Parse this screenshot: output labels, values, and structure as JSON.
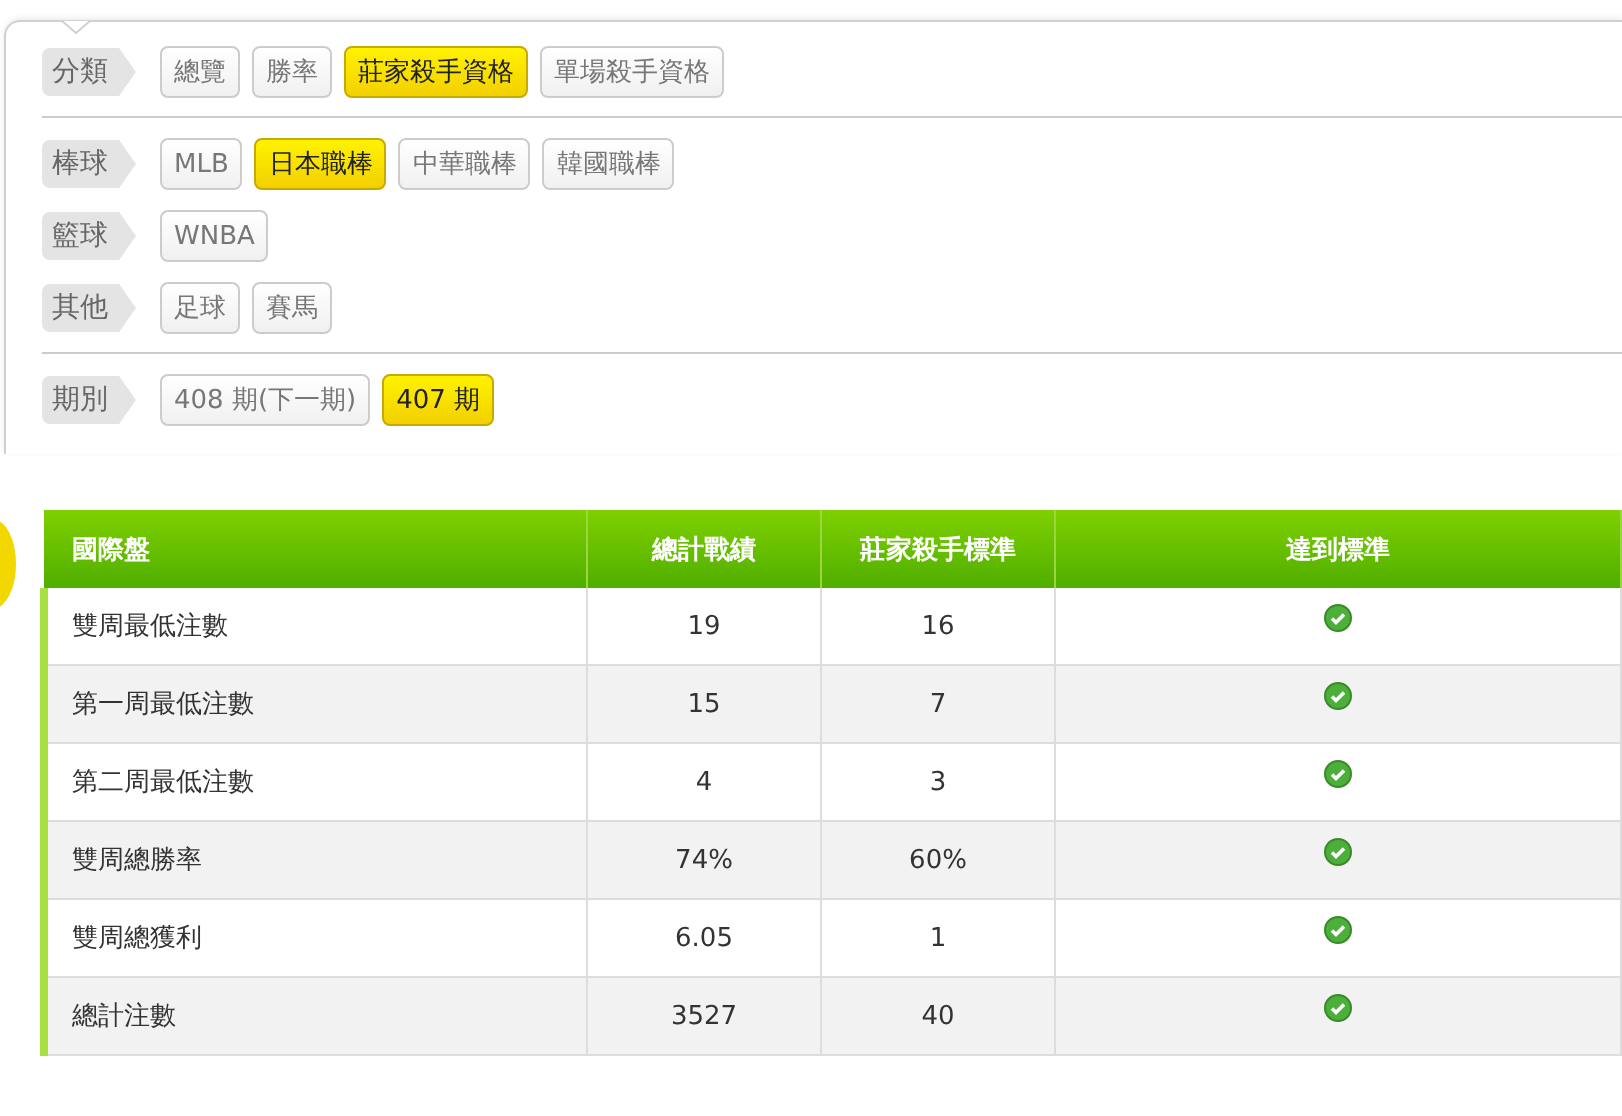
{
  "filter_sections": [
    {
      "groups": [
        {
          "label": "分類",
          "options": [
            {
              "label": "總覽",
              "selected": false
            },
            {
              "label": "勝率",
              "selected": false
            },
            {
              "label": "莊家殺手資格",
              "selected": true
            },
            {
              "label": "單場殺手資格",
              "selected": false
            }
          ]
        }
      ]
    },
    {
      "groups": [
        {
          "label": "棒球",
          "options": [
            {
              "label": "MLB",
              "selected": false
            },
            {
              "label": "日本職棒",
              "selected": true
            },
            {
              "label": "中華職棒",
              "selected": false
            },
            {
              "label": "韓國職棒",
              "selected": false
            }
          ]
        },
        {
          "label": "籃球",
          "options": [
            {
              "label": "WNBA",
              "selected": false
            }
          ]
        },
        {
          "label": "其他",
          "options": [
            {
              "label": "足球",
              "selected": false
            },
            {
              "label": "賽馬",
              "selected": false
            }
          ]
        }
      ]
    },
    {
      "groups": [
        {
          "label": "期別",
          "options": [
            {
              "label": "408 期(下一期)",
              "selected": false
            },
            {
              "label": "407 期",
              "selected": true
            }
          ]
        }
      ]
    }
  ],
  "table": {
    "columns": [
      "國際盤",
      "總計戰績",
      "莊家殺手標準",
      "達到標準"
    ],
    "rows": [
      {
        "cells": [
          "雙周最低注數",
          "19",
          "16"
        ],
        "met": true
      },
      {
        "cells": [
          "第一周最低注數",
          "15",
          "7"
        ],
        "met": true
      },
      {
        "cells": [
          "第二周最低注數",
          "4",
          "3"
        ],
        "met": true
      },
      {
        "cells": [
          "雙周總勝率",
          "74%",
          "60%"
        ],
        "met": true
      },
      {
        "cells": [
          "雙周總獲利",
          "6.05",
          "1"
        ],
        "met": true
      },
      {
        "cells": [
          "總計注數",
          "3527",
          "40"
        ],
        "met": true
      }
    ]
  }
}
